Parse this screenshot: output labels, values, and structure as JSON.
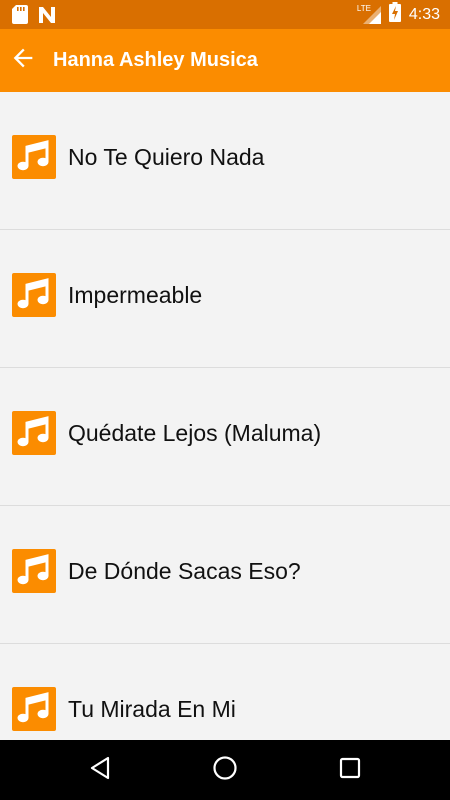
{
  "status_bar": {
    "time": "4:33",
    "network": "LTE",
    "icons": [
      "sd-card-icon",
      "n-notification-icon",
      "signal-icon",
      "battery-charging-icon"
    ]
  },
  "app_bar": {
    "title": "Hanna Ashley Musica",
    "back_icon": "arrow-back-icon",
    "color": "#fb8c00"
  },
  "songs": [
    {
      "title": "No Te Quiero Nada",
      "icon": "music-note-icon"
    },
    {
      "title": "Impermeable",
      "icon": "music-note-icon"
    },
    {
      "title": "Quédate Lejos (Maluma)",
      "icon": "music-note-icon"
    },
    {
      "title": "De Dónde Sacas Eso?",
      "icon": "music-note-icon"
    },
    {
      "title": "Tu Mirada En Mi",
      "icon": "music-note-icon"
    }
  ],
  "nav_bar": {
    "buttons": [
      "back-triangle-icon",
      "home-circle-icon",
      "recents-square-icon"
    ]
  },
  "colors": {
    "status_bar": "#d96f00",
    "accent": "#fb8c00",
    "background": "#f3f3f3"
  }
}
